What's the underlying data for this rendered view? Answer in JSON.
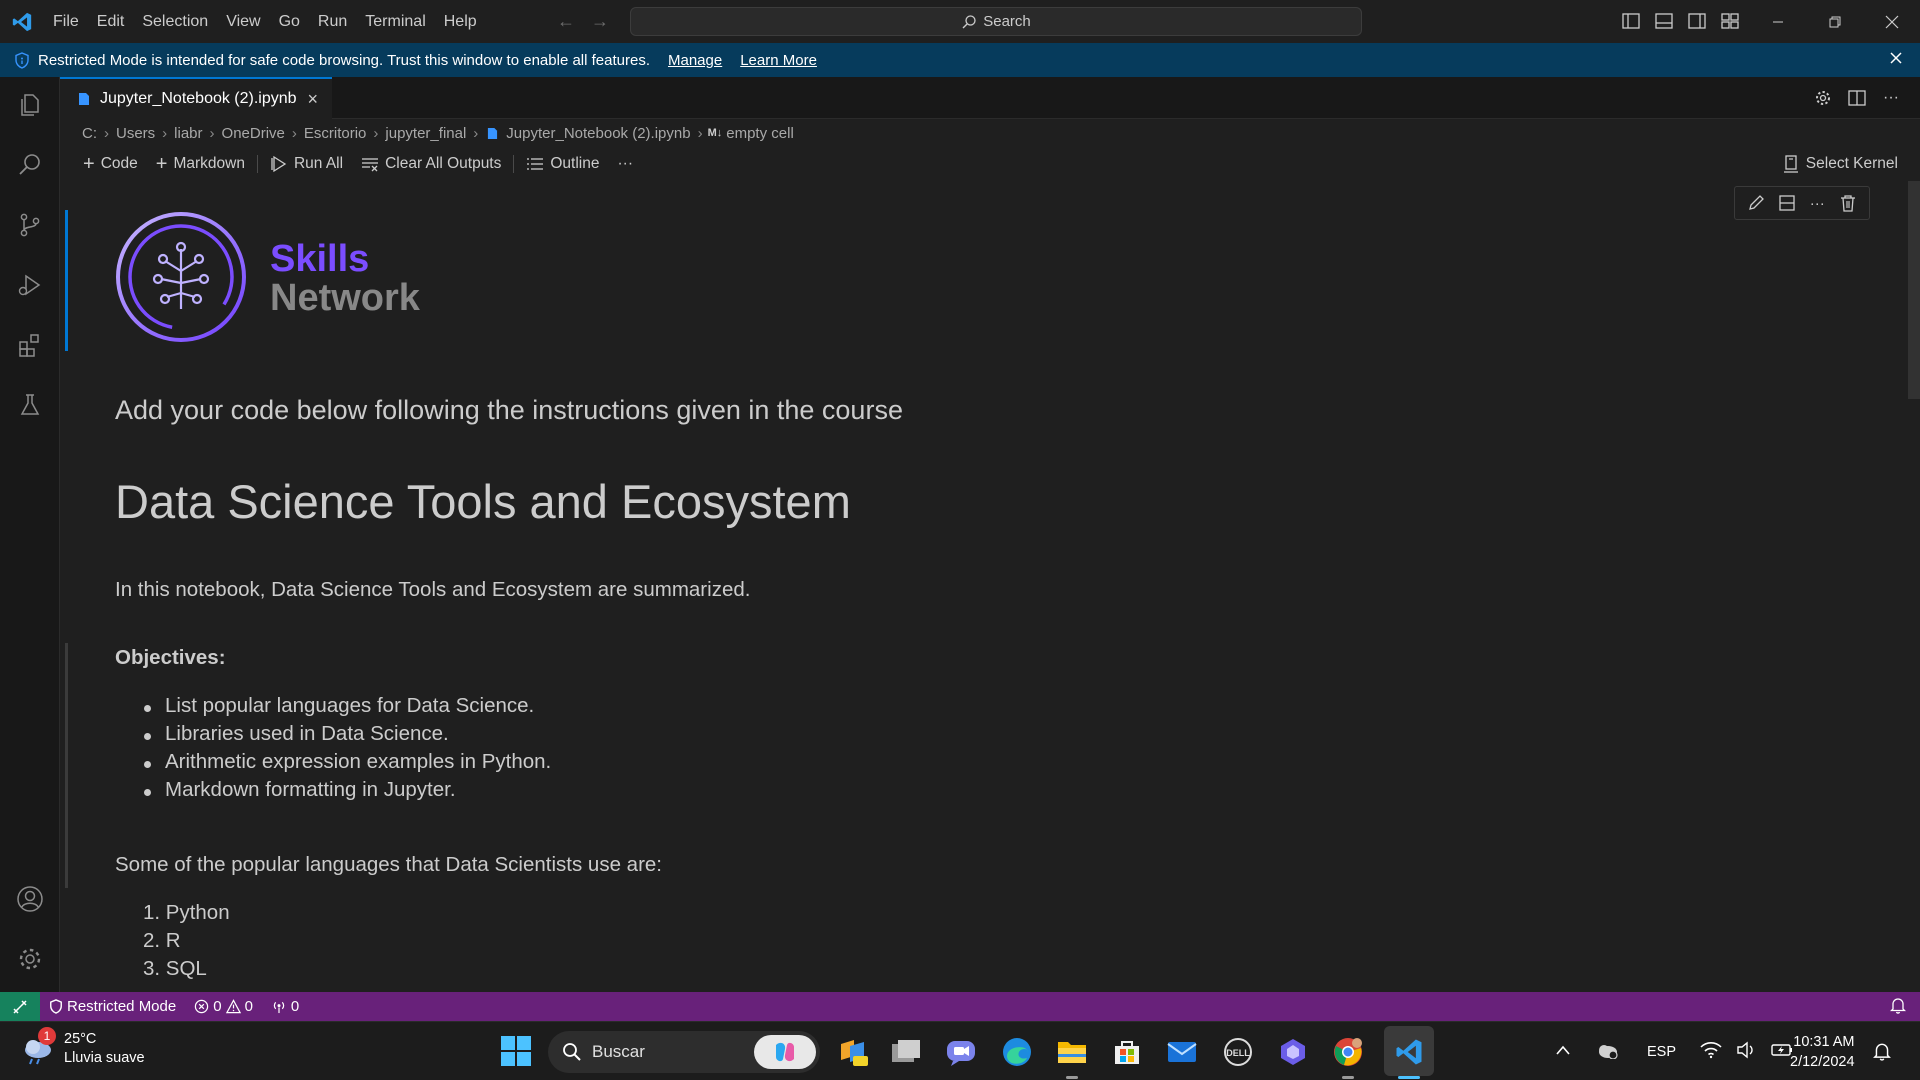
{
  "menu": [
    "File",
    "Edit",
    "Selection",
    "View",
    "Go",
    "Run",
    "Terminal",
    "Help"
  ],
  "search": {
    "label": "Search"
  },
  "banner": {
    "message": "Restricted Mode is intended for safe code browsing. Trust this window to enable all features.",
    "manage": "Manage",
    "learn_more": "Learn More"
  },
  "tab": {
    "title": "Jupyter_Notebook (2).ipynb",
    "close": "×"
  },
  "breadcrumb": [
    "C:",
    "Users",
    "liabr",
    "OneDrive",
    "Escritorio",
    "jupyter_final",
    "Jupyter_Notebook (2).ipynb",
    "empty cell"
  ],
  "breadcrumb_md_badge": "M↓",
  "toolbar": {
    "code": "Code",
    "markdown": "Markdown",
    "run_all": "Run All",
    "clear_outputs": "Clear All Outputs",
    "outline": "Outline",
    "more": "···",
    "kernel": "Select Kernel"
  },
  "logo": {
    "line1": "Skills",
    "line2": "Network",
    "primary_color": "#7b4dff"
  },
  "notebook": {
    "intro": "Add your code below following the instructions given in the course",
    "heading": "Data Science Tools and Ecosystem",
    "summary": "In this notebook, Data Science Tools and Ecosystem are summarized.",
    "objectives_label": "Objectives:",
    "objectives": [
      "List popular languages for Data Science.",
      "Libraries used in Data Science.",
      "Arithmetic expression examples in Python.",
      "Markdown formatting in Jupyter."
    ],
    "languages_intro": "Some of the popular languages that Data Scientists use are:",
    "languages": [
      "1. Python",
      "2. R",
      "3. SQL"
    ]
  },
  "statusbar": {
    "mode": "Restricted Mode",
    "errors": "0",
    "warnings": "0",
    "ports": "0",
    "bg_color": "#68217a"
  },
  "taskbar": {
    "temperature": "25°C",
    "weather": "Lluvia suave",
    "weather_badge": "1",
    "search_label": "Buscar",
    "language": "ESP",
    "time": "10:31 AM",
    "date": "2/12/2024"
  }
}
